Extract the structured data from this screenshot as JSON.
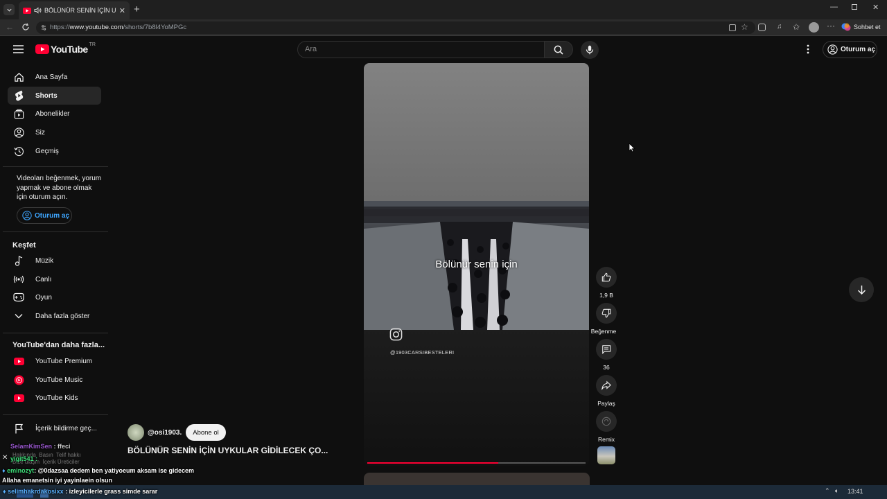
{
  "browser": {
    "tab_title": "BÖLÜNÜR SENİN İÇİN UYKULA",
    "url_prefix": "https://",
    "url_host": "www.youtube.com",
    "url_path": "/shorts/7b8l4YoMPGc",
    "copilot_label": "Sohbet et"
  },
  "youtube": {
    "logo_text": "YouTube",
    "region": "TR",
    "search_placeholder": "Ara",
    "signin_label": "Oturum aç"
  },
  "sidebar": {
    "main": [
      {
        "label": "Ana Sayfa",
        "icon": "home-icon"
      },
      {
        "label": "Shorts",
        "icon": "shorts-icon"
      },
      {
        "label": "Abonelikler",
        "icon": "subscriptions-icon"
      },
      {
        "label": "Siz",
        "icon": "you-icon"
      },
      {
        "label": "Geçmiş",
        "icon": "history-icon"
      }
    ],
    "signin_prompt": "Videoları beğenmek, yorum yapmak ve abone olmak için oturum açın.",
    "signin_button": "Oturum aç",
    "explore_title": "Keşfet",
    "explore": [
      {
        "label": "Müzik",
        "icon": "music-icon"
      },
      {
        "label": "Canlı",
        "icon": "live-icon"
      },
      {
        "label": "Oyun",
        "icon": "gaming-icon"
      },
      {
        "label": "Daha fazla göster",
        "icon": "chevron-down-icon"
      }
    ],
    "more_title": "YouTube'dan daha fazla...",
    "more": [
      {
        "label": "YouTube Premium"
      },
      {
        "label": "YouTube Music"
      },
      {
        "label": "YouTube Kids"
      }
    ],
    "report_label": "İçerik bildirme geç...",
    "footer_links": [
      "Hakkında",
      "Basın",
      "Telif hakkı",
      "Bize ulaşın",
      "İçerik Üreticiler"
    ]
  },
  "short": {
    "overlay_text": "Bölünür senin için",
    "watermark_handle": "@1903CARSIBESTELERI",
    "channel": "@osi1903.",
    "subscribe_label": "Abone ol",
    "title": "BÖLÜNÜR SENİN İÇİN UYKULAR GİDİLECEK ÇO...",
    "progress": 0.6,
    "actions": {
      "like_count": "1,9 B",
      "dislike_label": "Beğenme",
      "comment_count": "36",
      "share_label": "Paylaş",
      "remix_label": "Remix"
    }
  },
  "chat": [
    {
      "user": "SelamKimSen",
      "text": ": ffeci"
    },
    {
      "user": "yigit541",
      "text": ":"
    },
    {
      "user": "eminozyt",
      "text": ": @0dazsaa dedem ben yatiyoeum aksam ise gidecem"
    },
    {
      "user": "",
      "text": "Allaha emanetsin iyi yayinlaein olsun"
    },
    {
      "user": "selimhakrdakosixx",
      "text": ": izleyicilerle grass simde sarar"
    }
  ],
  "taskbar": {
    "time": "13:41"
  },
  "colors": {
    "accent": "#ff0033",
    "background": "#0f0f0f"
  }
}
